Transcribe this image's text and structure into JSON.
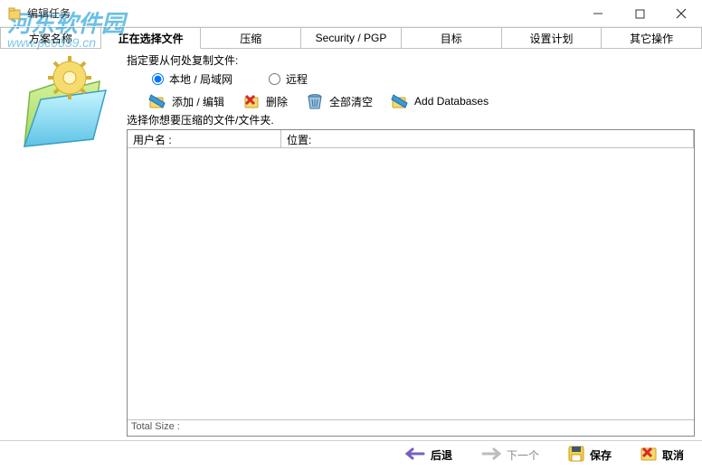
{
  "window": {
    "title": "编辑任务"
  },
  "watermark": {
    "line1": "河东软件园",
    "line2": "www.pc0359.cn"
  },
  "tabs": [
    "方案名称",
    "正在选择文件",
    "压缩",
    "Security / PGP",
    "目标",
    "设置计划",
    "其它操作"
  ],
  "active_tab_index": 1,
  "content": {
    "instruction": "指定要从何处复制文件:",
    "radio": {
      "local": "本地 / 局域网",
      "remote": "远程",
      "selected": "local"
    },
    "toolbar": {
      "add_edit": "添加 / 编辑",
      "delete": "删除",
      "clear_all": "全部清空",
      "add_db": "Add Databases"
    },
    "list_label": "选择你想要压缩的文件/文件夹.",
    "columns": [
      "用户名 :",
      "位置:"
    ],
    "footer_text": "Total Size :"
  },
  "footer": {
    "back": "后退",
    "next": "下一个",
    "save": "保存",
    "cancel": "取消"
  }
}
